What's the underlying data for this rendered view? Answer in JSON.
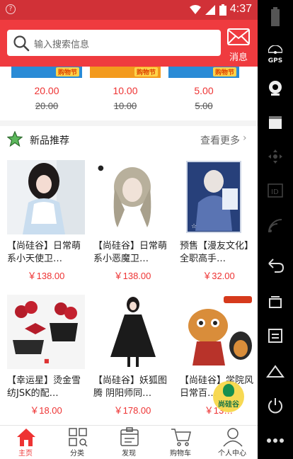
{
  "status_bar": {
    "time": "4:37",
    "sim_glyph": "?"
  },
  "header": {
    "search_placeholder": "输入搜索信息",
    "message_label": "消息"
  },
  "promo": {
    "tag_label": "购物节",
    "items": [
      {
        "price": "20.00",
        "old_price": "20.00",
        "tag_color": "#2a8bd6"
      },
      {
        "price": "10.00",
        "old_price": "10.00",
        "tag_color": "#f39a1d"
      },
      {
        "price": "5.00",
        "old_price": "5.00",
        "tag_color": "#2a8bd6"
      }
    ]
  },
  "new_products": {
    "title": "新品推荐",
    "more": "查看更多",
    "items": [
      {
        "name": "【尚硅谷】日常萌系小天使卫…",
        "price": "￥138.00",
        "icon": "lolita-figure-image"
      },
      {
        "name": "【尚硅谷】日常萌系小恶魔卫…",
        "price": "￥138.00",
        "icon": "wig-figure-image"
      },
      {
        "name": "预售【漫友文化】全职高手…",
        "price": "￥32.00",
        "icon": "book-cover-image"
      },
      {
        "name": "【幸运星】烫金雪纺JSK的配…",
        "price": "￥18.00",
        "icon": "accessories-image"
      },
      {
        "name": "【尚硅谷】妖狐图腾 阴阳师同…",
        "price": "￥178.00",
        "icon": "black-dress-image"
      },
      {
        "name": "【尚硅谷】学院风 日常百…",
        "price": "￥13…",
        "icon": "tiger-plush-image"
      }
    ]
  },
  "badge": {
    "label": "尚硅谷"
  },
  "tabbar": {
    "tabs": [
      {
        "label": "主页",
        "active": true
      },
      {
        "label": "分类"
      },
      {
        "label": "发现"
      },
      {
        "label": "购物车"
      },
      {
        "label": "个人中心"
      }
    ]
  },
  "colors": {
    "accent": "#ef3b3f",
    "price": "#e33333",
    "status": "#d13137"
  }
}
